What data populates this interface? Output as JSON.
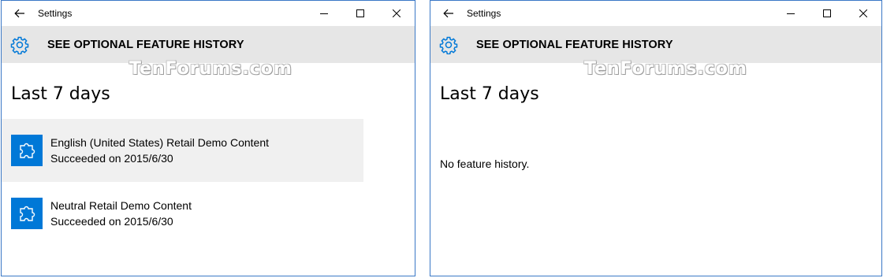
{
  "watermark": "TenForums.com",
  "colors": {
    "accent": "#0078d7",
    "header_bg": "#e6e6e6",
    "selected_bg": "#f0f0f0",
    "window_border": "#3a78c6"
  },
  "left_window": {
    "title": "Settings",
    "page_title": "SEE OPTIONAL FEATURE HISTORY",
    "section_title": "Last 7 days",
    "items": [
      {
        "name": "English (United States) Retail Demo Content",
        "status": "Succeeded on 2015/6/30",
        "icon": "puzzle-icon",
        "selected": true
      },
      {
        "name": "Neutral Retail Demo Content",
        "status": "Succeeded on 2015/6/30",
        "icon": "puzzle-icon",
        "selected": false
      }
    ]
  },
  "right_window": {
    "title": "Settings",
    "page_title": "SEE OPTIONAL FEATURE HISTORY",
    "section_title": "Last 7 days",
    "empty_message": "No feature history."
  }
}
